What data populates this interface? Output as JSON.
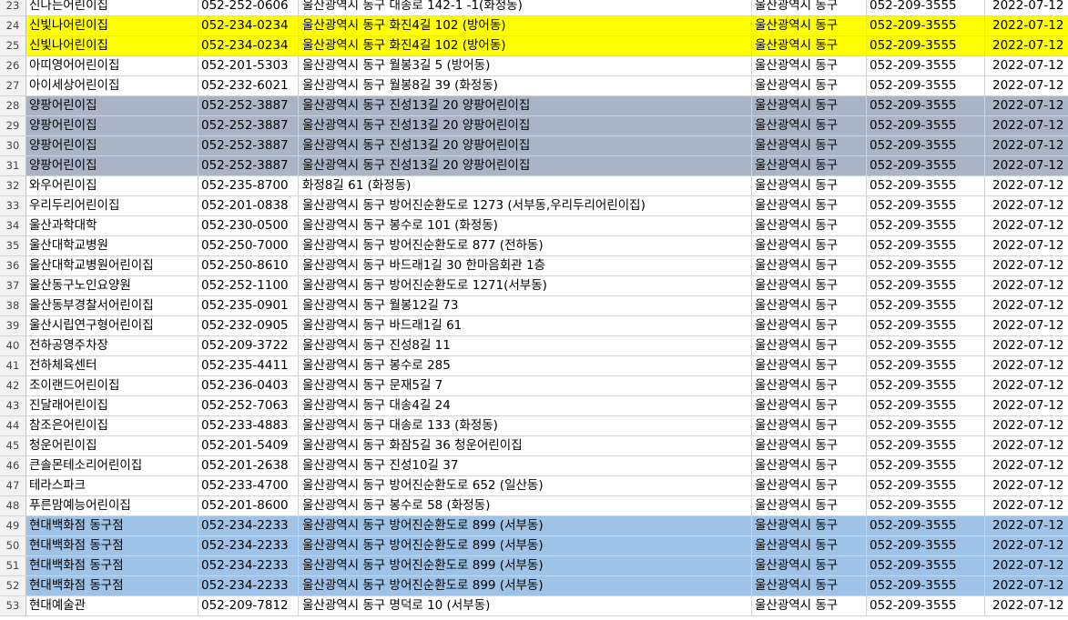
{
  "colors": {
    "yellow": "#ffff00",
    "gray_blue": "#aab4c7",
    "light_blue": "#9ec3e6",
    "header_bg": "#f2f2f2"
  },
  "rows": [
    {
      "num": "23",
      "name": "신나는어린이집",
      "phone": "052-252-0606",
      "address": " 울산광역시 동구 대송로 142-1 -1(화정동)",
      "district": "울산광역시 동구",
      "contact": "052-209-3555",
      "date": "2022-07-12",
      "fill": ""
    },
    {
      "num": "24",
      "name": "신빛나어린이집",
      "phone": "052-234-0234",
      "address": "울산광역시 동구  화진4길 102 (방어동)",
      "district": "울산광역시 동구",
      "contact": "052-209-3555",
      "date": "2022-07-12",
      "fill": "#ffff00"
    },
    {
      "num": "25",
      "name": "신빛나어린이집",
      "phone": "052-234-0234",
      "address": "울산광역시 동구  화진4길 102 (방어동)",
      "district": "울산광역시 동구",
      "contact": "052-209-3555",
      "date": "2022-07-12",
      "fill": "#ffff00"
    },
    {
      "num": "26",
      "name": "아띠영어어린이집",
      "phone": "052-201-5303",
      "address": " 울산광역시 동구 월봉3길 5 (방어동)",
      "district": "울산광역시 동구",
      "contact": "052-209-3555",
      "date": "2022-07-12",
      "fill": ""
    },
    {
      "num": "27",
      "name": "아이세상어린이집",
      "phone": "052-232-6021",
      "address": "울산광역시 동구  월봉8길 39 (화정동)",
      "district": "울산광역시 동구",
      "contact": "052-209-3555",
      "date": "2022-07-12",
      "fill": ""
    },
    {
      "num": "28",
      "name": "양팡어린이집",
      "phone": "052-252-3887",
      "address": "울산광역시 동구  진성13길 20 양팡어린이집",
      "district": "울산광역시 동구",
      "contact": "052-209-3555",
      "date": "2022-07-12",
      "fill": "#aab4c7"
    },
    {
      "num": "29",
      "name": "양팡어린이집",
      "phone": "052-252-3887",
      "address": "울산광역시 동구  진성13길 20 양팡어린이집",
      "district": "울산광역시 동구",
      "contact": "052-209-3555",
      "date": "2022-07-12",
      "fill": "#aab4c7"
    },
    {
      "num": "30",
      "name": "양팡어린이집",
      "phone": "052-252-3887",
      "address": "울산광역시 동구  진성13길 20 양팡어린이집",
      "district": "울산광역시 동구",
      "contact": "052-209-3555",
      "date": "2022-07-12",
      "fill": "#aab4c7"
    },
    {
      "num": "31",
      "name": "양팡어린이집",
      "phone": "052-252-3887",
      "address": "울산광역시 동구  진성13길 20 양팡어린이집",
      "district": "울산광역시 동구",
      "contact": "052-209-3555",
      "date": "2022-07-12",
      "fill": "#aab4c7"
    },
    {
      "num": "32",
      "name": "와우어린이집",
      "phone": "052-235-8700",
      "address": " 화정8길 61 (화정동)",
      "district": "울산광역시 동구",
      "contact": "052-209-3555",
      "date": "2022-07-12",
      "fill": ""
    },
    {
      "num": "33",
      "name": "우리두리어린이집",
      "phone": "052-201-0838",
      "address": "울산광역시 동구  방어진순환도로 1273 (서부동,우리두리어린이집)",
      "district": "울산광역시 동구",
      "contact": "052-209-3555",
      "date": "2022-07-12",
      "fill": ""
    },
    {
      "num": "34",
      "name": "울산과학대학",
      "phone": "052-230-0500",
      "address": "울산광역시 동구 봉수로 101 (화정동)",
      "district": "울산광역시 동구",
      "contact": "052-209-3555",
      "date": "2022-07-12",
      "fill": ""
    },
    {
      "num": "35",
      "name": "울산대학교병원",
      "phone": "052-250-7000",
      "address": "울산광역시 동구 방어진순환도로 877 (전하동)",
      "district": "울산광역시 동구",
      "contact": "052-209-3555",
      "date": "2022-07-12",
      "fill": ""
    },
    {
      "num": "36",
      "name": "울산대학교병원어린이집",
      "phone": "052-250-8610",
      "address": "울산광역시 동구  바드래1길 30 한마음회관 1층",
      "district": "울산광역시 동구",
      "contact": "052-209-3555",
      "date": "2022-07-12",
      "fill": ""
    },
    {
      "num": "37",
      "name": "울산동구노인요양원",
      "phone": "052-252-1100",
      "address": "울산광역시 동구 방어진순환도로 1271(서부동)",
      "district": "울산광역시 동구",
      "contact": "052-209-3555",
      "date": "2022-07-12",
      "fill": ""
    },
    {
      "num": "38",
      "name": "울산동부경찰서어린이집",
      "phone": "052-235-0901",
      "address": "울산광역시 동구  월봉12길 73",
      "district": "울산광역시 동구",
      "contact": "052-209-3555",
      "date": "2022-07-12",
      "fill": ""
    },
    {
      "num": "39",
      "name": "울산시립연구형어린이집",
      "phone": "052-232-0905",
      "address": "울산광역시 동구 바드래1길 61",
      "district": "울산광역시 동구",
      "contact": "052-209-3555",
      "date": "2022-07-12",
      "fill": ""
    },
    {
      "num": "40",
      "name": "전하공영주차장",
      "phone": "052-209-3722",
      "address": "울산광역시 동구 진성8길 11",
      "district": "울산광역시 동구",
      "contact": "052-209-3555",
      "date": "2022-07-12",
      "fill": ""
    },
    {
      "num": "41",
      "name": "전하체육센터",
      "phone": "052-235-4411",
      "address": "울산광역시 동구 봉수로 285",
      "district": "울산광역시 동구",
      "contact": "052-209-3555",
      "date": "2022-07-12",
      "fill": ""
    },
    {
      "num": "42",
      "name": "조이랜드어린이집",
      "phone": "052-236-0403",
      "address": "울산광역시 동구  문재5길 7",
      "district": "울산광역시 동구",
      "contact": "052-209-3555",
      "date": "2022-07-12",
      "fill": ""
    },
    {
      "num": "43",
      "name": "진달래어린이집",
      "phone": "052-252-7063",
      "address": " 울산광역시 동구 대송4길 24",
      "district": "울산광역시 동구",
      "contact": "052-209-3555",
      "date": "2022-07-12",
      "fill": ""
    },
    {
      "num": "44",
      "name": "참조은어린이집",
      "phone": "052-233-4883",
      "address": "울산광역시 동구  대송로 133 (화정동)",
      "district": "울산광역시 동구",
      "contact": "052-209-3555",
      "date": "2022-07-12",
      "fill": ""
    },
    {
      "num": "45",
      "name": "청운어린이집",
      "phone": "052-201-5409",
      "address": "울산광역시 동구  화잠5길 36 청운어린이집",
      "district": "울산광역시 동구",
      "contact": "052-209-3555",
      "date": "2022-07-12",
      "fill": ""
    },
    {
      "num": "46",
      "name": "큰솔몬테소리어린이집",
      "phone": "052-201-2638",
      "address": "울산광역시 동구  진성10길 37",
      "district": "울산광역시 동구",
      "contact": "052-209-3555",
      "date": "2022-07-12",
      "fill": ""
    },
    {
      "num": "47",
      "name": "테라스파크",
      "phone": "052-233-4700",
      "address": "울산광역시 동구 방어진순환도로 652 (일산동)",
      "district": "울산광역시 동구",
      "contact": "052-209-3555",
      "date": "2022-07-12",
      "fill": ""
    },
    {
      "num": "48",
      "name": "푸른맘예능어린이집",
      "phone": "052-201-8600",
      "address": "울산광역시 동구  봉수로 58 (화정동)",
      "district": "울산광역시 동구",
      "contact": "052-209-3555",
      "date": "2022-07-12",
      "fill": ""
    },
    {
      "num": "49",
      "name": "현대백화점 동구점",
      "phone": "052-234-2233",
      "address": "울산광역시 동구 방어진순환도로 899 (서부동)",
      "district": "울산광역시 동구",
      "contact": "052-209-3555",
      "date": "2022-07-12",
      "fill": "#9ec3e6"
    },
    {
      "num": "50",
      "name": "현대백화점 동구점",
      "phone": "052-234-2233",
      "address": "울산광역시 동구 방어진순환도로 899 (서부동)",
      "district": "울산광역시 동구",
      "contact": "052-209-3555",
      "date": "2022-07-12",
      "fill": "#9ec3e6"
    },
    {
      "num": "51",
      "name": "현대백화점 동구점",
      "phone": "052-234-2233",
      "address": "울산광역시 동구 방어진순환도로 899 (서부동)",
      "district": "울산광역시 동구",
      "contact": "052-209-3555",
      "date": "2022-07-12",
      "fill": "#9ec3e6"
    },
    {
      "num": "52",
      "name": "현대백화점 동구점",
      "phone": "052-234-2233",
      "address": "울산광역시 동구 방어진순환도로 899 (서부동)",
      "district": "울산광역시 동구",
      "contact": "052-209-3555",
      "date": "2022-07-12",
      "fill": "#9ec3e6"
    },
    {
      "num": "53",
      "name": "현대예술관",
      "phone": "052-209-7812",
      "address": "울산광역시 동구 명덕로 10 (서부동)",
      "district": "울산광역시 동구",
      "contact": "052-209-3555",
      "date": "2022-07-12",
      "fill": ""
    }
  ]
}
